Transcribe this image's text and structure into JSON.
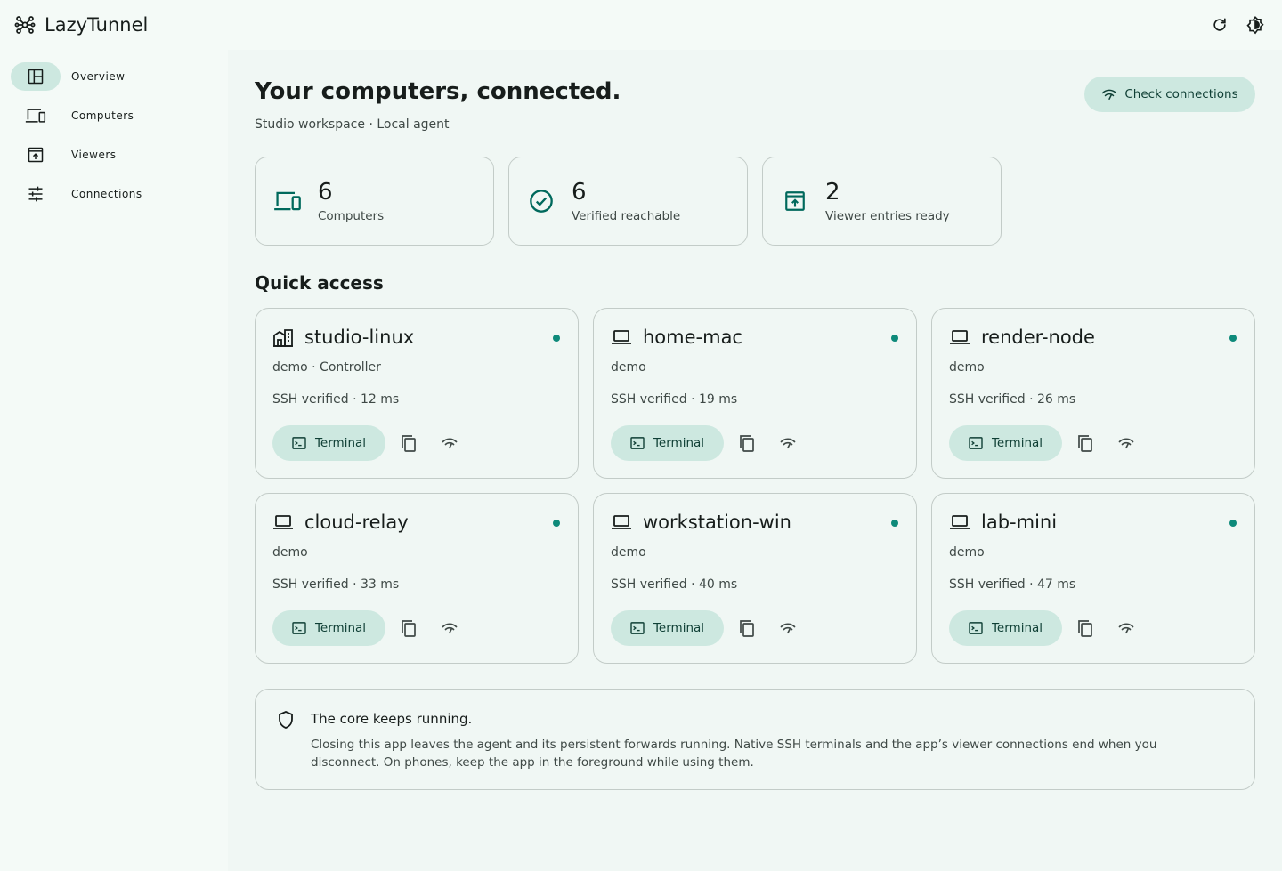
{
  "app": {
    "title": "LazyTunnel"
  },
  "sidebar": {
    "items": [
      {
        "label": "Overview",
        "icon": "overview-icon",
        "active": true
      },
      {
        "label": "Computers",
        "icon": "devices-icon",
        "active": false
      },
      {
        "label": "Viewers",
        "icon": "viewer-icon",
        "active": false
      },
      {
        "label": "Connections",
        "icon": "tune-icon",
        "active": false
      }
    ]
  },
  "header": {
    "title": "Your computers, connected.",
    "subtitle": "Studio workspace · Local agent",
    "check_button": "Check connections"
  },
  "stats": [
    {
      "value": "6",
      "label": "Computers",
      "icon": "devices-icon"
    },
    {
      "value": "6",
      "label": "Verified reachable",
      "icon": "check-circle-icon"
    },
    {
      "value": "2",
      "label": "Viewer entries ready",
      "icon": "viewer-icon"
    }
  ],
  "quick_access": {
    "title": "Quick access",
    "terminal_label": "Terminal",
    "computers": [
      {
        "name": "studio-linux",
        "meta": "demo · Controller",
        "ssh": "SSH verified · 12 ms",
        "icon": "building-icon"
      },
      {
        "name": "home-mac",
        "meta": "demo",
        "ssh": "SSH verified · 19 ms",
        "icon": "laptop-icon"
      },
      {
        "name": "render-node",
        "meta": "demo",
        "ssh": "SSH verified · 26 ms",
        "icon": "laptop-icon"
      },
      {
        "name": "cloud-relay",
        "meta": "demo",
        "ssh": "SSH verified · 33 ms",
        "icon": "laptop-icon"
      },
      {
        "name": "workstation-win",
        "meta": "demo",
        "ssh": "SSH verified · 40 ms",
        "icon": "laptop-icon"
      },
      {
        "name": "lab-mini",
        "meta": "demo",
        "ssh": "SSH verified · 47 ms",
        "icon": "laptop-icon"
      }
    ]
  },
  "info": {
    "title": "The core keeps running.",
    "body": "Closing this app leaves the agent and its persistent forwards running. Native SSH terminals and the app’s viewer connections end when you disconnect. On phones, keep the app in the foreground while using them."
  },
  "colors": {
    "accent": "#0e8a7a",
    "tonal": "#cde8e0",
    "background": "#f4faf7",
    "surface": "#f0f7f4",
    "outline": "#c3ccc8"
  }
}
